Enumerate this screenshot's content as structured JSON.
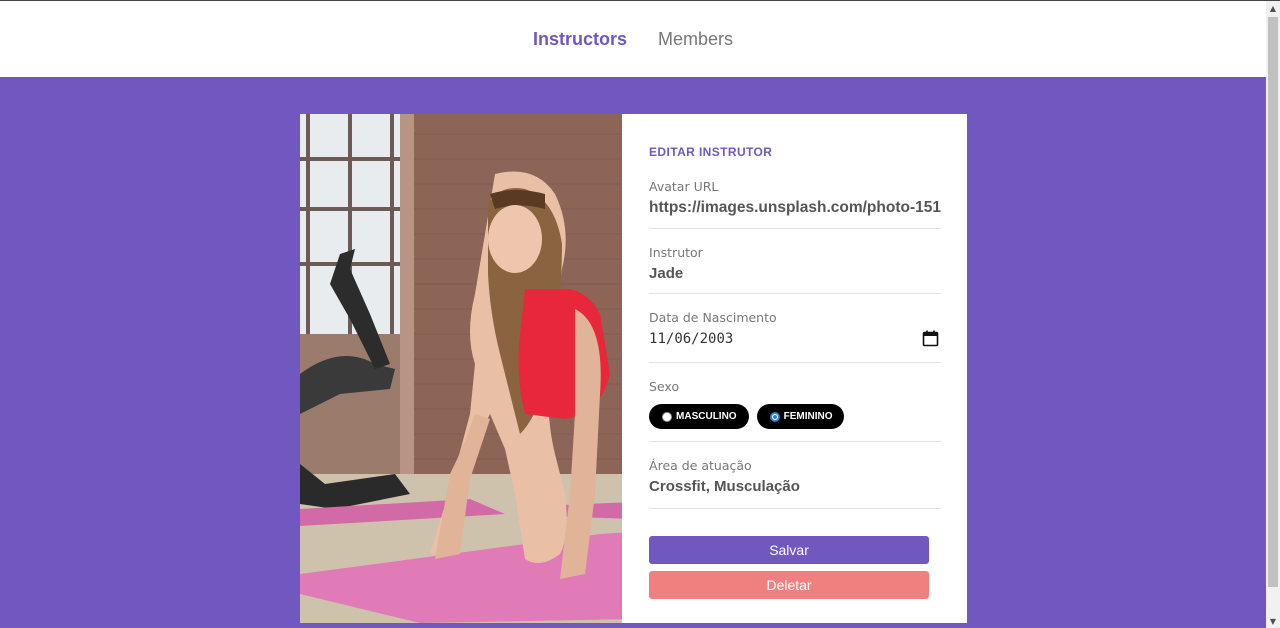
{
  "nav": {
    "items": [
      {
        "label": "Instructors",
        "active": true
      },
      {
        "label": "Members",
        "active": false
      }
    ]
  },
  "colors": {
    "accent": "#7157c0",
    "delete": "#f08080",
    "pill": "#000000"
  },
  "photo": {
    "description_icon": "instructor-photo"
  },
  "form": {
    "title": "EDITAR INSTRUTOR",
    "avatar": {
      "label": "Avatar URL",
      "value": "https://images.unsplash.com/photo-151"
    },
    "instructor": {
      "label": "Instrutor",
      "value": "Jade"
    },
    "birth": {
      "label": "Data de Nascimento",
      "value": "11/06/2003",
      "icon": "calendar-icon"
    },
    "gender": {
      "label": "Sexo",
      "options": [
        {
          "label": "MASCULINO",
          "checked": false
        },
        {
          "label": "FEMININO",
          "checked": true
        }
      ]
    },
    "area": {
      "label": "Área de atuação",
      "value": "Crossfit, Musculação"
    },
    "save_label": "Salvar",
    "delete_label": "Deletar"
  }
}
